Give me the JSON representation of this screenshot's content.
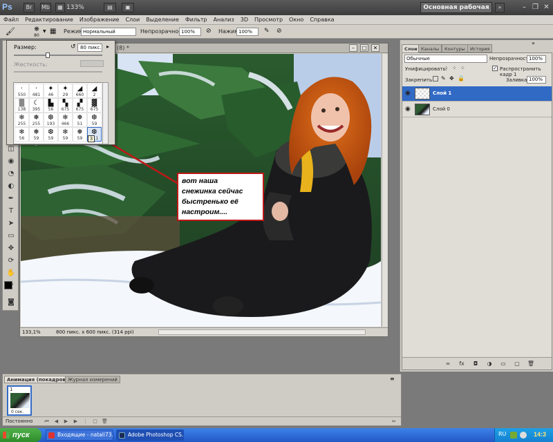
{
  "app": {
    "logo": "Ps",
    "zoom": "133%",
    "workspace_button": "Основная рабочая среда",
    "window_controls": [
      "minimize-icon",
      "restore-icon",
      "close-icon"
    ]
  },
  "menu": [
    "Файл",
    "Редактирование",
    "Изображение",
    "Слои",
    "Выделение",
    "Фильтр",
    "Анализ",
    "3D",
    "Просмотр",
    "Окно",
    "Справка"
  ],
  "options_bar": {
    "brush_size": "80",
    "mode_label": "Режим:",
    "mode_value": "Нормальный",
    "opacity_label": "Непрозрачность:",
    "opacity_value": "100%",
    "pressure_label": "Нажим:",
    "pressure_value": "100%"
  },
  "brush_picker": {
    "size_label": "Размер:",
    "size_value": "80 пикс.",
    "hardness_label": "Жесткость:",
    "size_level_percent": 38,
    "brushes": [
      {
        "glyph": "·",
        "num": "550"
      },
      {
        "glyph": "·",
        "num": "481"
      },
      {
        "glyph": "✦",
        "num": "46"
      },
      {
        "glyph": "✦",
        "num": "29"
      },
      {
        "glyph": "◢",
        "num": "660"
      },
      {
        "glyph": "◢",
        "num": "2"
      },
      {
        "glyph": "▒",
        "num": "138"
      },
      {
        "glyph": "☾",
        "num": "395"
      },
      {
        "glyph": "▙",
        "num": "56"
      },
      {
        "glyph": "▚",
        "num": "675"
      },
      {
        "glyph": "▞",
        "num": "675"
      },
      {
        "glyph": "▓",
        "num": "675"
      },
      {
        "glyph": "❄",
        "num": "255"
      },
      {
        "glyph": "❅",
        "num": "255"
      },
      {
        "glyph": "❆",
        "num": "193"
      },
      {
        "glyph": "❄",
        "num": "466"
      },
      {
        "glyph": "❅",
        "num": "51"
      },
      {
        "glyph": "❆",
        "num": "59"
      },
      {
        "glyph": "❄",
        "num": "56"
      },
      {
        "glyph": "❅",
        "num": "59"
      },
      {
        "glyph": "❆",
        "num": "59"
      },
      {
        "glyph": "❄",
        "num": "59"
      },
      {
        "glyph": "❅",
        "num": "59"
      },
      {
        "glyph": "❆",
        "num": "111"
      }
    ],
    "selected_index": 23,
    "tooltip": "3"
  },
  "document": {
    "title": "(8) *",
    "zoom_pct": "133,1%",
    "size_info": "800 пикс. x 600 пикс. (314 ppi)"
  },
  "annotation": {
    "lines": [
      "вот наша",
      "снежинка сейчас",
      "быстренько её",
      "настроим...."
    ]
  },
  "layers_panel": {
    "tabs": [
      "Слои",
      "Каналы",
      "Контуры",
      "История"
    ],
    "blend_mode": "Обычные",
    "opacity_label": "Непрозрачность:",
    "opacity_value": "100%",
    "unify_label": "Унифицировать:",
    "propagate_label": "Распространить кадр 1",
    "lock_label": "Закрепить:",
    "fill_label": "Заливка:",
    "fill_value": "100%",
    "layers": [
      {
        "name": "Слой 1",
        "selected": true
      },
      {
        "name": "Слой 0",
        "selected": false
      }
    ]
  },
  "animation_panel": {
    "tabs": [
      "Анимация (покадровая)",
      "Журнал измерений"
    ],
    "frame_number": "1",
    "frame_time": "0 сек.",
    "loop": "Постоянно"
  },
  "taskbar": {
    "start": "пуск",
    "items": [
      {
        "label": "Входящие - natali73...",
        "active": false
      },
      {
        "label": "Adobe Photoshop CS...",
        "active": true
      }
    ],
    "lang": "RU",
    "clock": "14:3"
  },
  "colors": {
    "selection_blue": "#316ac5",
    "callout_border": "#c01818",
    "arrow": "#c01818"
  }
}
